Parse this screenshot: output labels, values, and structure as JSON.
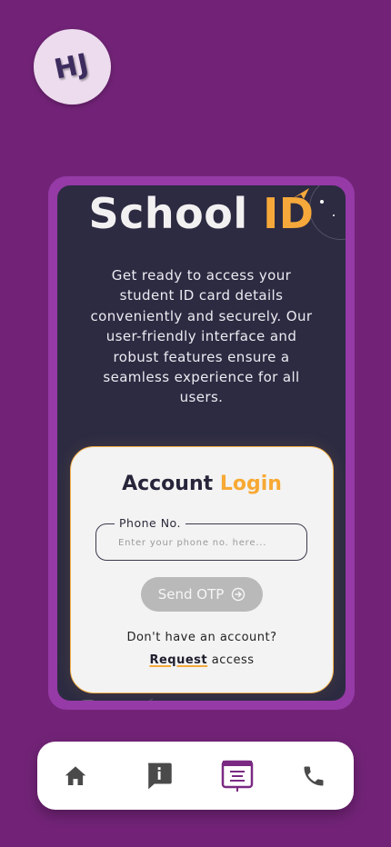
{
  "avatar": {
    "initials": "HJ"
  },
  "brand": {
    "part1": "School ",
    "part2": "ID"
  },
  "intro": "Get ready to access your student ID card details conveniently and securely. Our user-friendly interface and robust features ensure a seamless experience for all users.",
  "login": {
    "title_part1": "Account ",
    "title_part2": "Login",
    "phone_label": "Phone No.",
    "phone_placeholder": "Enter your phone no. here...",
    "phone_value": "",
    "send_otp_label": "Send OTP",
    "no_account_text": "Don't have an account?",
    "request_link": "Request",
    "request_suffix": " access"
  },
  "tabs": [
    {
      "icon": "home-icon"
    },
    {
      "icon": "info-icon"
    },
    {
      "icon": "id-card-icon",
      "active": true
    },
    {
      "icon": "phone-icon"
    }
  ],
  "colors": {
    "background": "#722377",
    "frame": "#953aa6",
    "screen": "#2c2b42",
    "accent": "#f6a93a",
    "active_tab": "#7a2a82"
  }
}
